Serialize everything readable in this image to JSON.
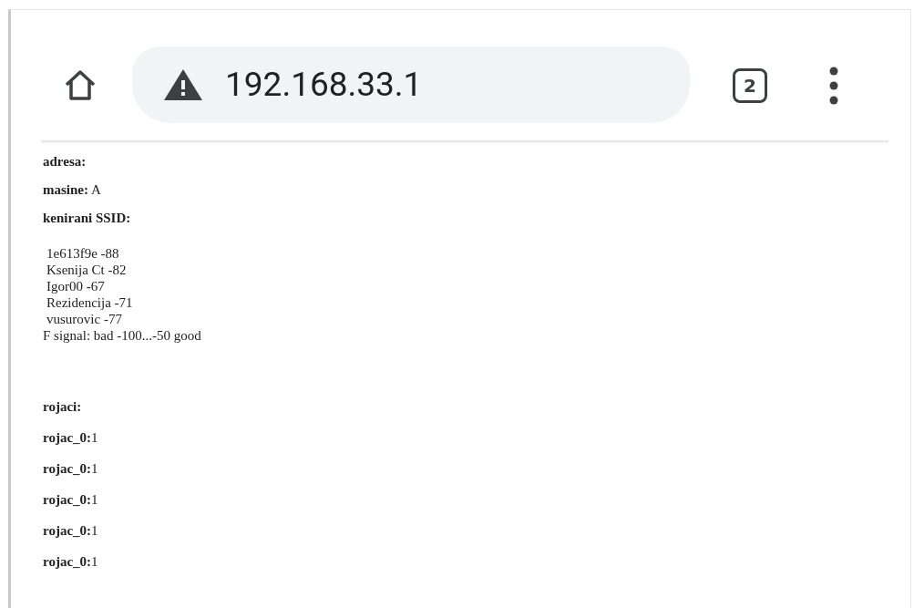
{
  "toolbar": {
    "url": "192.168.33.1",
    "tab_count": "2"
  },
  "fields": [
    {
      "label": "adresa:"
    },
    {
      "label": "masine:",
      "value": " A"
    },
    {
      "label": "kenirani SSID:"
    }
  ],
  "ssid_lines": [
    "1e613f9e -88",
    "Ksenija Ct -82",
    "Igor00 -67",
    "Rezidencija -71",
    "vusurovic -77",
    "F signal: bad -100...-50 good"
  ],
  "counters_title": "rojaci:",
  "counters": [
    {
      "label": "rojac_0:",
      "value": "1"
    },
    {
      "label": "rojac_0:",
      "value": "1"
    },
    {
      "label": "rojac_0:",
      "value": "1"
    },
    {
      "label": "rojac_0:",
      "value": "1"
    },
    {
      "label": "rojac_0:",
      "value": "1"
    }
  ]
}
